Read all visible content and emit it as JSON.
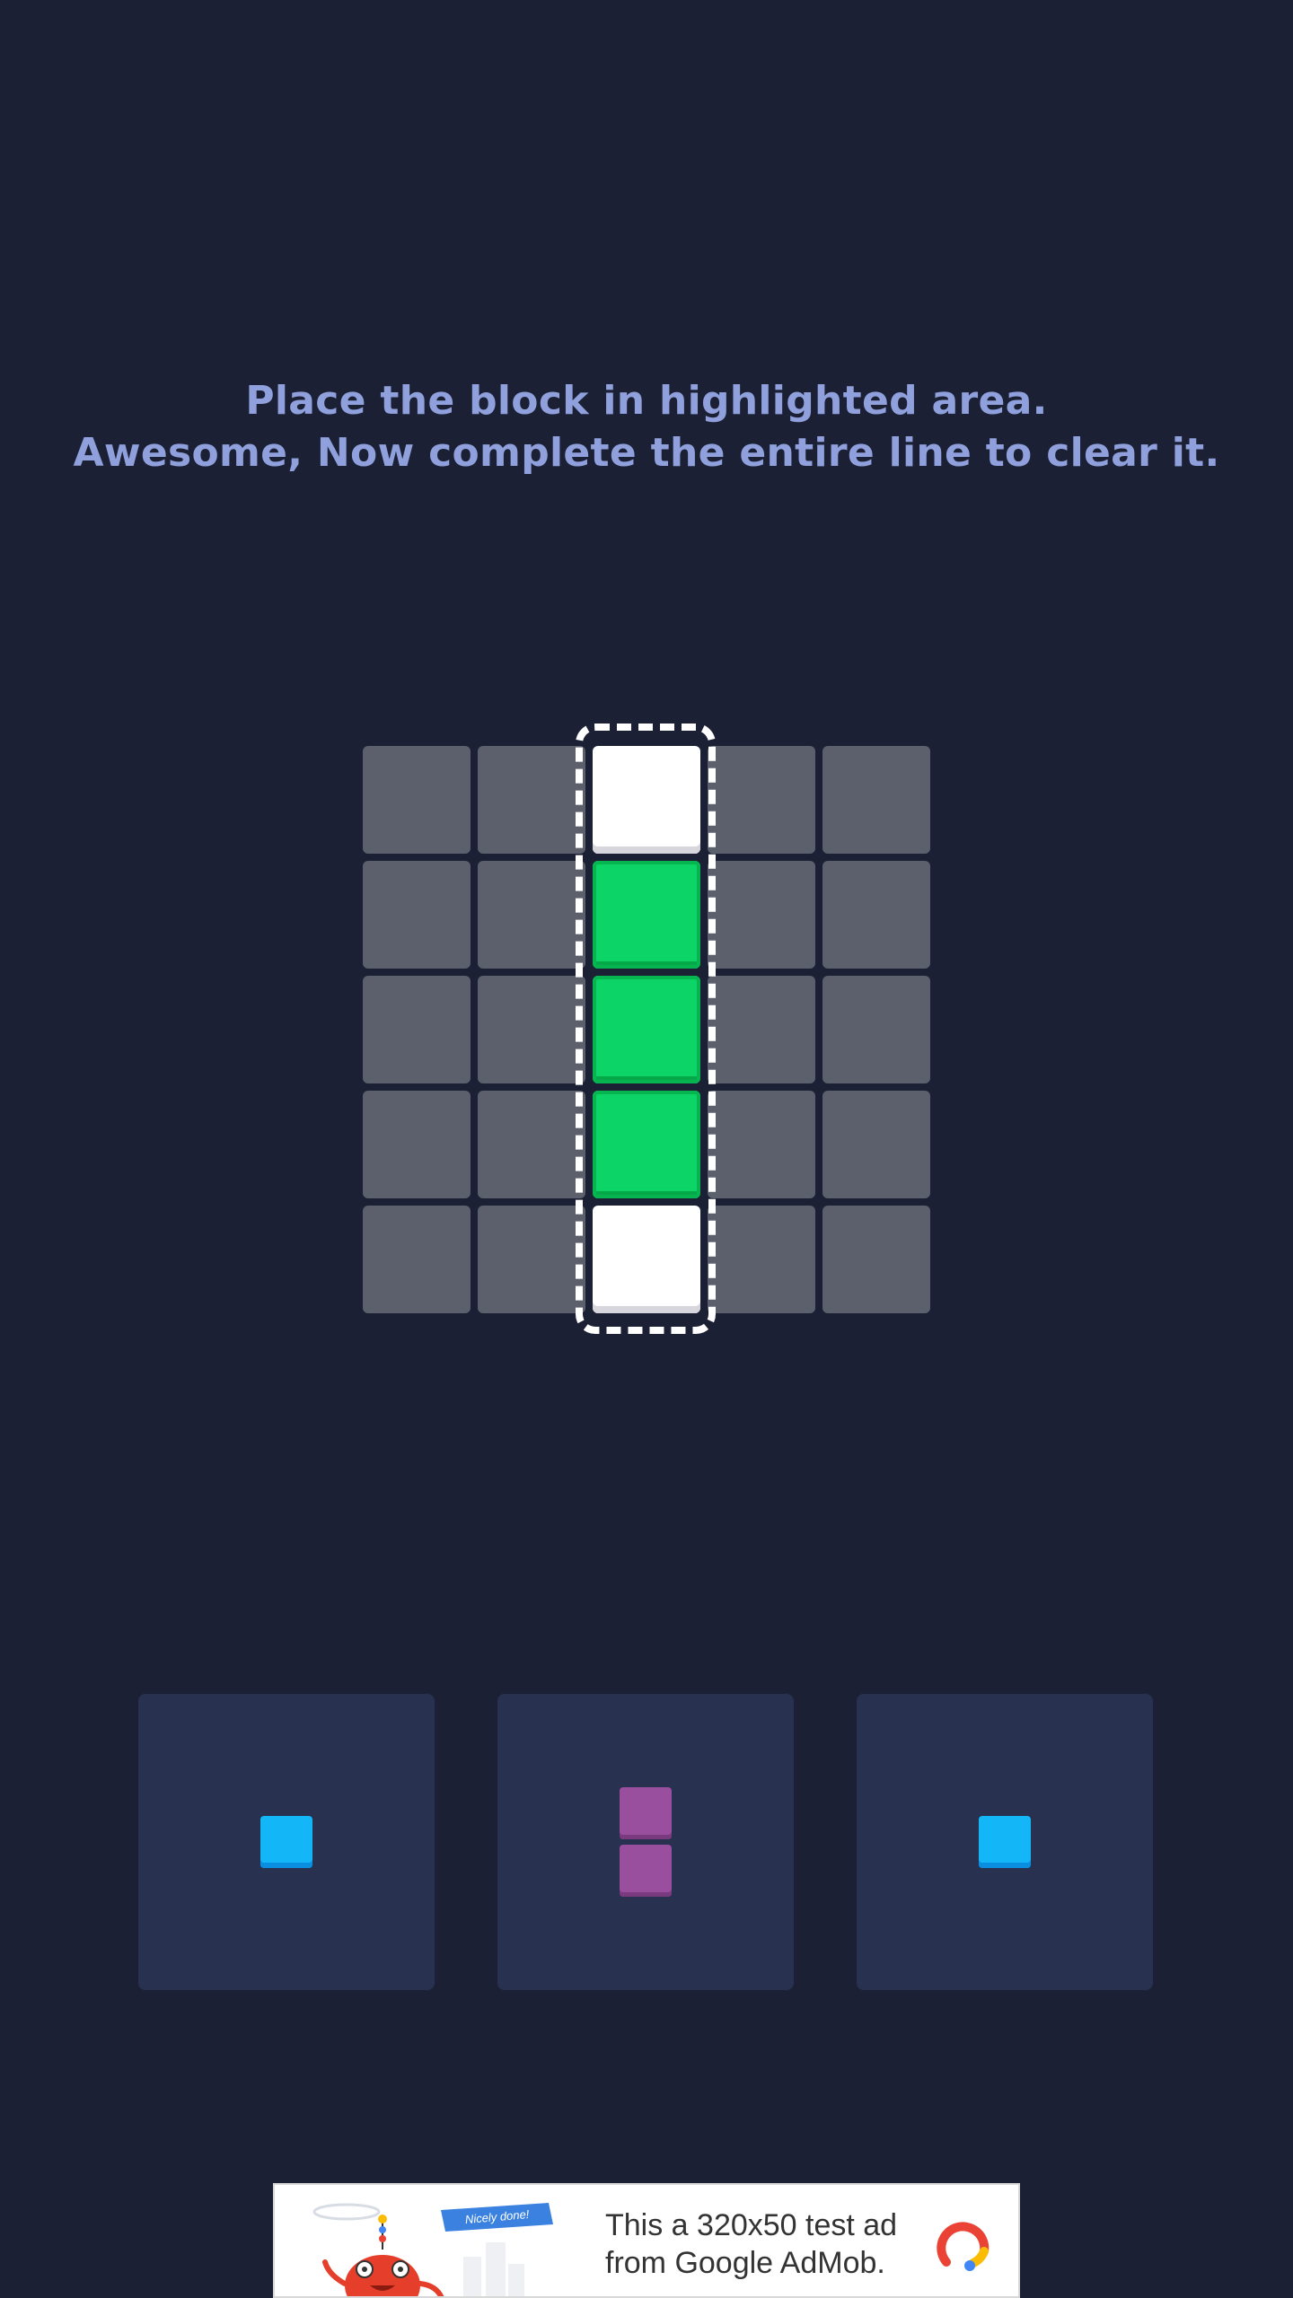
{
  "tutorial": {
    "line1": "Place the block in highlighted area.",
    "line2": "Awesome, Now complete the entire line to clear it."
  },
  "board": {
    "rows": 5,
    "cols": 5,
    "cells": [
      [
        "empty",
        "empty",
        "white",
        "empty",
        "empty"
      ],
      [
        "empty",
        "empty",
        "green",
        "empty",
        "empty"
      ],
      [
        "empty",
        "empty",
        "green",
        "empty",
        "empty"
      ],
      [
        "empty",
        "empty",
        "green",
        "empty",
        "empty"
      ],
      [
        "empty",
        "empty",
        "white",
        "empty",
        "empty"
      ]
    ],
    "highlighted_column": 2
  },
  "tray": {
    "pieces": [
      {
        "color": "blue",
        "cells": 1,
        "orientation": "single"
      },
      {
        "color": "purple",
        "cells": 2,
        "orientation": "vertical"
      },
      {
        "color": "blue",
        "cells": 1,
        "orientation": "single"
      }
    ]
  },
  "colors": {
    "background": "#1b2034",
    "empty_cell": "#5b606c",
    "green_block": "#0cd466",
    "blue_block": "#13b7f8",
    "purple_block": "#9a4f9e",
    "tray_slot": "#283250",
    "text": "#8fa0dc"
  },
  "ad": {
    "line1": "This a 320x50 test ad",
    "line2": "from Google AdMob.",
    "ribbon_text": "Nicely done!",
    "logo_icon": "admob-logo-icon"
  }
}
